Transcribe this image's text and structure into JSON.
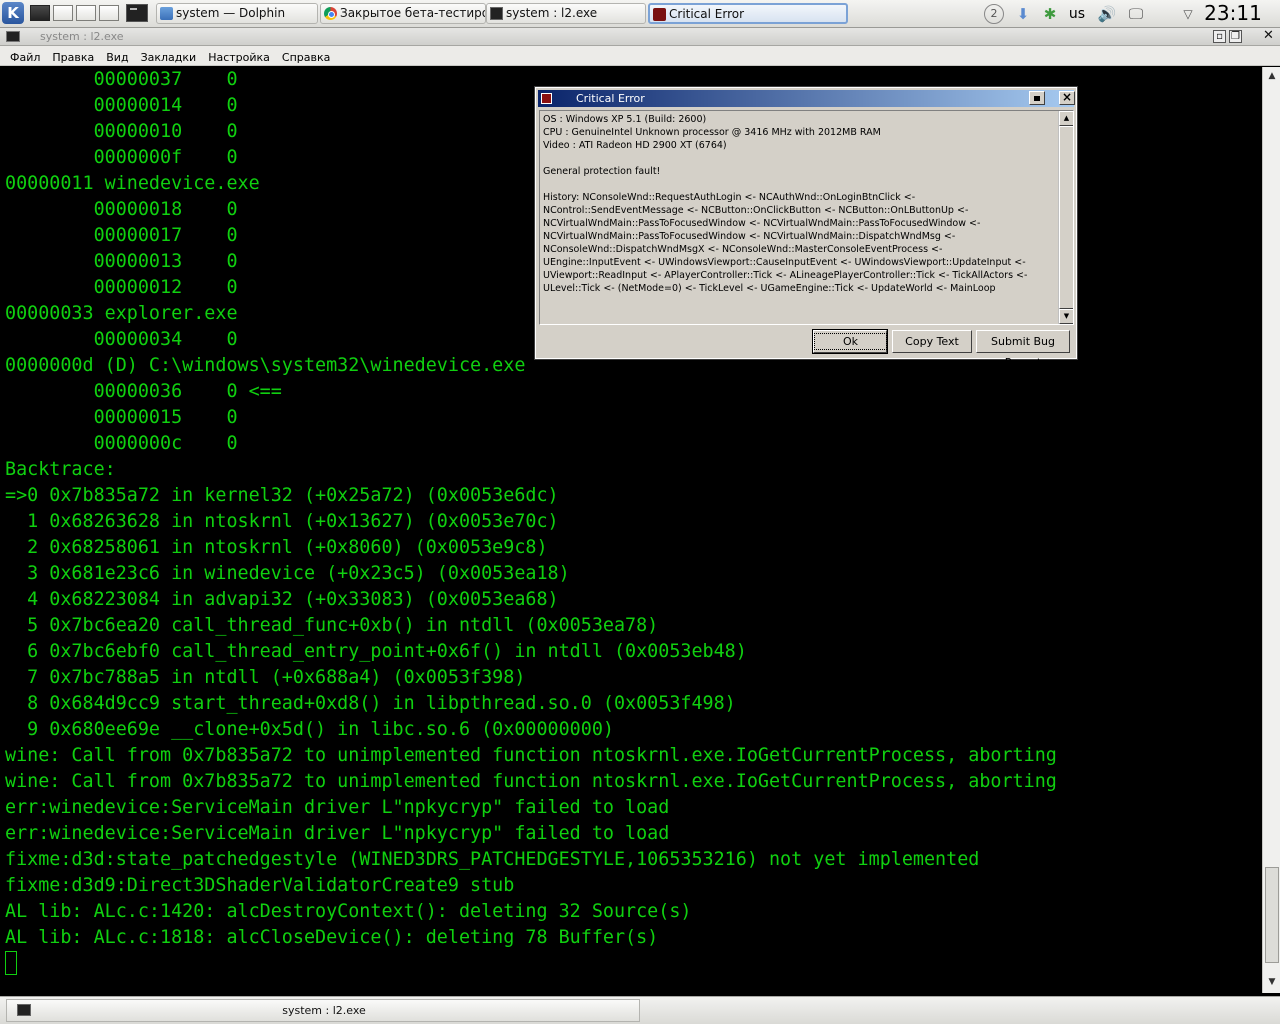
{
  "panel": {
    "kmenu_label": "K",
    "tasks": [
      {
        "label": "system — Dolphin"
      },
      {
        "label": "Закрытое бета-тестирова"
      },
      {
        "label": "system : l2.exe"
      },
      {
        "label": "Critical Error"
      }
    ],
    "tray": {
      "keyboard_layout": "us",
      "clock": "23:11"
    }
  },
  "window": {
    "title": "system : l2.exe",
    "menu": [
      "Файл",
      "Правка",
      "Вид",
      "Закладки",
      "Настройка",
      "Справка"
    ]
  },
  "terminal": {
    "lines": [
      "        00000037    0",
      "        00000014    0",
      "        00000010    0",
      "        0000000f    0",
      "00000011 winedevice.exe",
      "        00000018    0",
      "        00000017    0",
      "        00000013    0",
      "        00000012    0",
      "00000033 explorer.exe",
      "        00000034    0",
      "0000000d (D) C:\\windows\\system32\\winedevice.exe",
      "        00000036    0 <==",
      "        00000015    0",
      "        0000000c    0",
      "Backtrace:",
      "=>0 0x7b835a72 in kernel32 (+0x25a72) (0x0053e6dc)",
      "  1 0x68263628 in ntoskrnl (+0x13627) (0x0053e70c)",
      "  2 0x68258061 in ntoskrnl (+0x8060) (0x0053e9c8)",
      "  3 0x681e23c6 in winedevice (+0x23c5) (0x0053ea18)",
      "  4 0x68223084 in advapi32 (+0x33083) (0x0053ea68)",
      "  5 0x7bc6ea20 call_thread_func+0xb() in ntdll (0x0053ea78)",
      "  6 0x7bc6ebf0 call_thread_entry_point+0x6f() in ntdll (0x0053eb48)",
      "  7 0x7bc788a5 in ntdll (+0x688a4) (0x0053f398)",
      "  8 0x684d9cc9 start_thread+0xd8() in libpthread.so.0 (0x0053f498)",
      "  9 0x680ee69e __clone+0x5d() in libc.so.6 (0x00000000)",
      "wine: Call from 0x7b835a72 to unimplemented function ntoskrnl.exe.IoGetCurrentProcess, aborting",
      "wine: Call from 0x7b835a72 to unimplemented function ntoskrnl.exe.IoGetCurrentProcess, aborting",
      "err:winedevice:ServiceMain driver L\"npkycryp\" failed to load",
      "err:winedevice:ServiceMain driver L\"npkycryp\" failed to load",
      "fixme:d3d:state_patchedgestyle (WINED3DRS_PATCHEDGESTYLE,1065353216) not yet implemented",
      "fixme:d3d9:Direct3DShaderValidatorCreate9 stub",
      "AL lib: ALc.c:1420: alcDestroyContext(): deleting 32 Source(s)",
      "AL lib: ALc.c:1818: alcCloseDevice(): deleting 78 Buffer(s)"
    ]
  },
  "dialog": {
    "title": "Critical Error",
    "lines": [
      "OS : Windows XP 5.1 (Build: 2600)",
      "CPU : GenuineIntel Unknown processor @ 3416 MHz with 2012MB RAM",
      "Video : ATI Radeon HD 2900 XT (6764)",
      "",
      "General protection fault!",
      "",
      "History: NConsoleWnd::RequestAuthLogin <- NCAuthWnd::OnLoginBtnClick <-",
      "NControl::SendEventMessage <- NCButton::OnClickButton <- NCButton::OnLButtonUp <-",
      "NCVirtualWndMain::PassToFocusedWindow <- NCVirtualWndMain::PassToFocusedWindow <-",
      "NCVirtualWndMain::PassToFocusedWindow <- NCVirtualWndMain::DispatchWndMsg <-",
      "NConsoleWnd::DispatchWndMsgX <- NConsoleWnd::MasterConsoleEventProcess <-",
      "UEngine::InputEvent <- UWindowsViewport::CauseInputEvent <- UWindowsViewport::UpdateInput <-",
      "UViewport::ReadInput <- APlayerController::Tick <- ALineagePlayerController::Tick <- TickAllActors <-",
      "ULevel::Tick <- (NetMode=0) <- TickLevel <- UGameEngine::Tick <- UpdateWorld <- MainLoop"
    ],
    "buttons": {
      "ok": "Ok",
      "copy": "Copy Text",
      "report": "Submit Bug Report"
    }
  },
  "bottom_panel": {
    "task_label": "system : l2.exe"
  }
}
